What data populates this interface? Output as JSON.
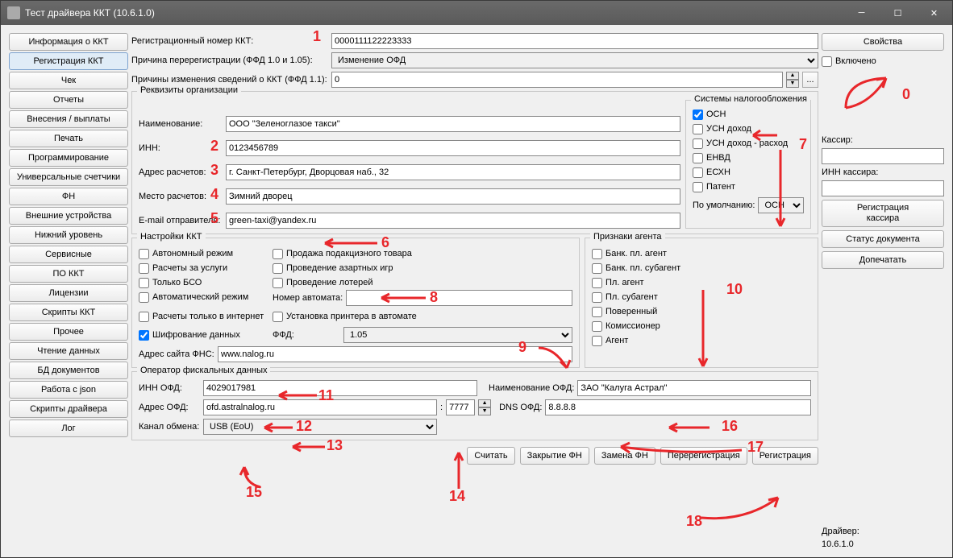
{
  "window": {
    "title": "Тест драйвера ККТ (10.6.1.0)"
  },
  "sidebar": {
    "items": [
      "Информация о ККТ",
      "Регистрация ККТ",
      "Чек",
      "Отчеты",
      "Внесения / выплаты",
      "Печать",
      "Программирование",
      "Универсальные счетчики",
      "ФН",
      "Внешние устройства",
      "Нижний уровень",
      "Сервисные",
      "ПО ККТ",
      "Лицензии",
      "Скрипты ККТ",
      "Прочее",
      "Чтение данных",
      "БД документов",
      "Работа с json",
      "Скрипты драйвера",
      "Лог"
    ],
    "active_index": 1
  },
  "top": {
    "reg_num_label": "Регистрационный номер ККТ:",
    "reg_num_value": "0000111122223333",
    "rereg_reason_label": "Причина перерегистрации (ФФД 1.0 и 1.05):",
    "rereg_reason_value": "Изменение ОФД",
    "change_reason_label": "Причины изменения сведений о ККТ (ФФД 1.1):",
    "change_reason_value": "0",
    "ellipsis": "..."
  },
  "org": {
    "legend": "Реквизиты организации",
    "name_label": "Наименование:",
    "name_value": "ООО \"Зеленоглазое такси\"",
    "inn_label": "ИНН:",
    "inn_value": "0123456789",
    "addr_label": "Адрес расчетов:",
    "addr_value": "г. Санкт-Петербург, Дворцовая наб., 32",
    "place_label": "Место расчетов:",
    "place_value": "Зимний дворец",
    "email_label": "E-mail отправителя:",
    "email_value": "green-taxi@yandex.ru"
  },
  "tax": {
    "legend": "Системы налогообложения",
    "items": [
      "ОСН",
      "УСН доход",
      "УСН доход - расход",
      "ЕНВД",
      "ЕСХН",
      "Патент"
    ],
    "checked": [
      true,
      false,
      false,
      false,
      false,
      false
    ],
    "default_label": "По умолчанию:",
    "default_value": "ОСН"
  },
  "kkt": {
    "legend": "Настройки ККТ",
    "col1": [
      "Автономный режим",
      "Расчеты за услуги",
      "Только БСО",
      "Автоматический режим"
    ],
    "col2": [
      "Продажа подакцизного товара",
      "Проведение азартных игр",
      "Проведение лотерей"
    ],
    "automat_label": "Номер автомата:",
    "internet_label": "Расчеты только в интернет",
    "printer_label": "Установка принтера в автомате",
    "encrypt_label": "Шифрование данных",
    "encrypt_checked": true,
    "ffd_label": "ФФД:",
    "ffd_value": "1.05",
    "fns_label": "Адрес сайта ФНС:",
    "fns_value": "www.nalog.ru"
  },
  "agent": {
    "legend": "Признаки агента",
    "items": [
      "Банк. пл. агент",
      "Банк. пл. субагент",
      "Пл. агент",
      "Пл. субагент",
      "Поверенный",
      "Комиссионер",
      "Агент"
    ]
  },
  "ofd": {
    "legend": "Оператор фискальных данных",
    "inn_label": "ИНН ОФД:",
    "inn_value": "4029017981",
    "name_label": "Наименование ОФД:",
    "name_value": "ЗАО \"Калуга Астрал\"",
    "addr_label": "Адрес ОФД:",
    "addr_value": "ofd.astralnalog.ru",
    "port_value": "7777",
    "dns_label": "DNS ОФД:",
    "dns_value": "8.8.8.8",
    "channel_label": "Канал обмена:",
    "channel_value": "USB (EoU)"
  },
  "bottom_buttons": [
    "Считать",
    "Закрытие ФН",
    "Замена ФН",
    "Перерегистрация",
    "Регистрация"
  ],
  "right": {
    "properties": "Свойства",
    "enabled_label": "Включено",
    "cashier_label": "Кассир:",
    "cashier_inn_label": "ИНН кассира:",
    "reg_cashier": "Регистрация\nкассира",
    "doc_status": "Статус документа",
    "print_extra": "Допечатать",
    "driver_label": "Драйвер:",
    "driver_version": "10.6.1.0"
  },
  "annotations": {
    "0": "0",
    "1": "1",
    "2": "2",
    "3": "3",
    "4": "4",
    "5": "5",
    "6": "6",
    "7": "7",
    "8": "8",
    "9": "9",
    "10": "10",
    "11": "11",
    "12": "12",
    "13": "13",
    "14": "14",
    "15": "15",
    "16": "16",
    "17": "17",
    "18": "18"
  }
}
